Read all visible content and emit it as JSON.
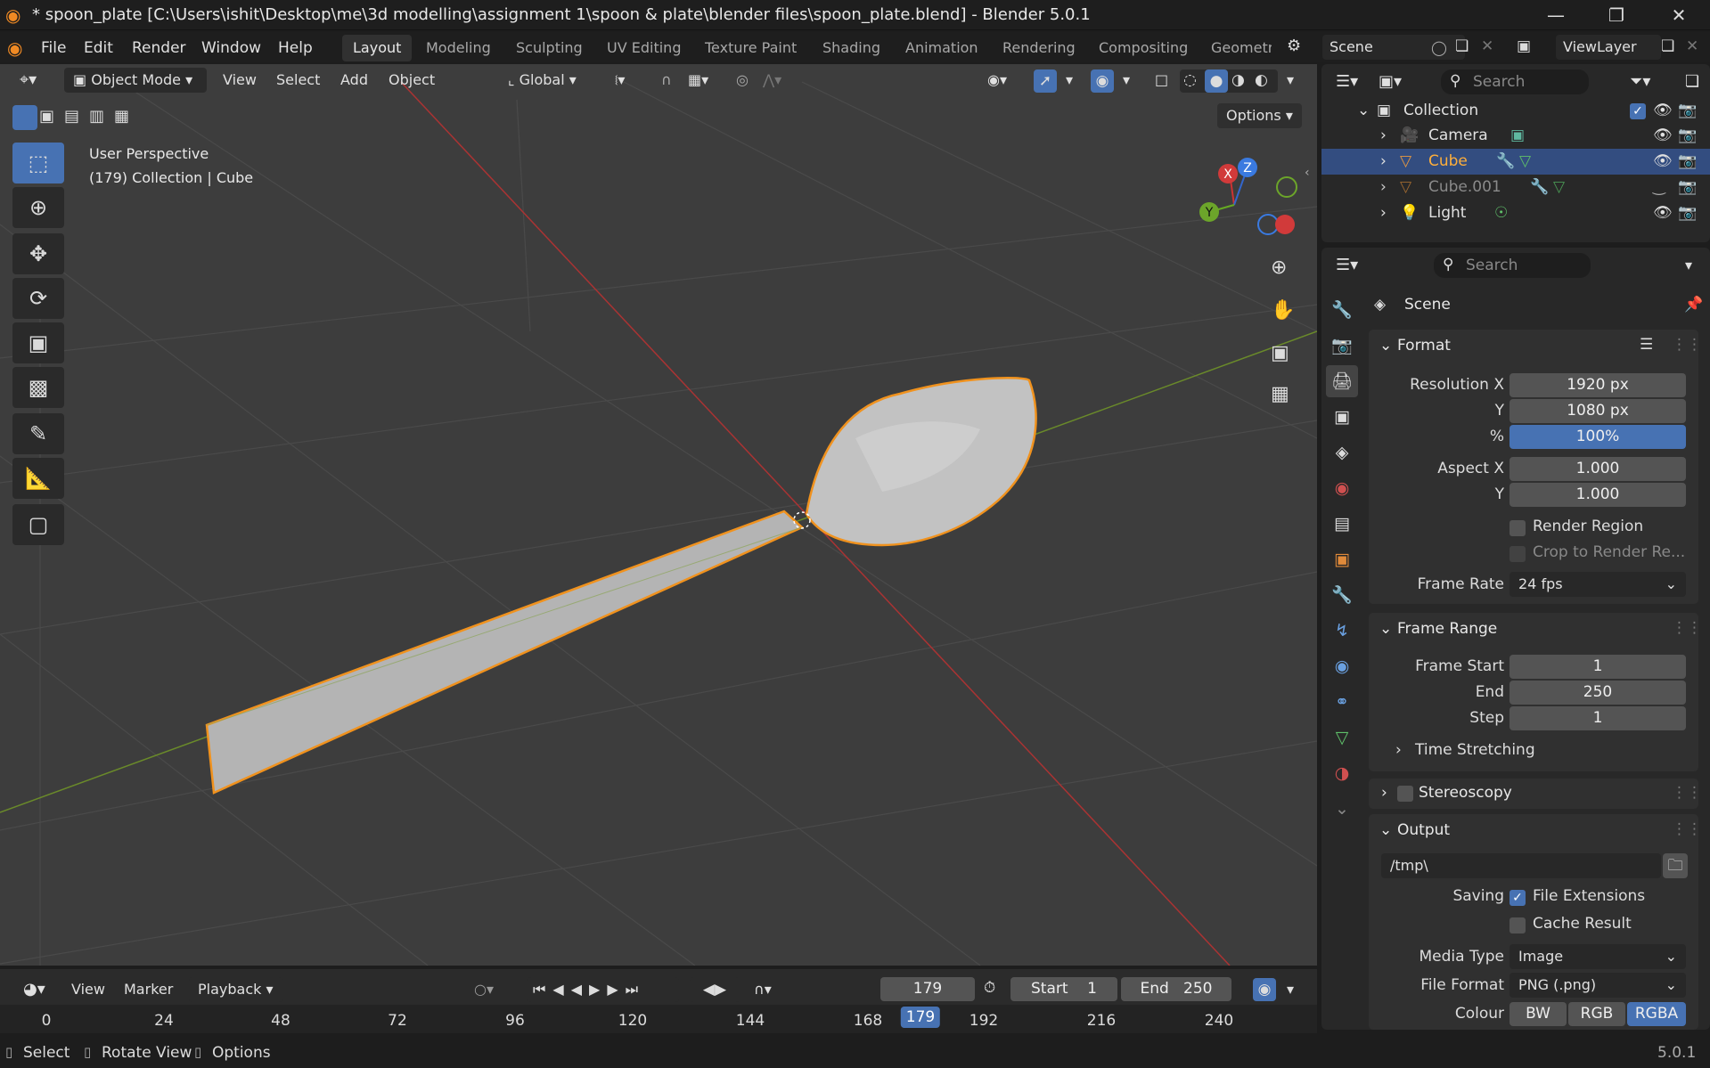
{
  "title_bar": {
    "title": "* spoon_plate [C:\\Users\\ishit\\Desktop\\me\\3d modelling\\assignment 1\\spoon & plate\\blender files\\spoon_plate.blend] - Blender 5.0.1"
  },
  "menu": [
    "File",
    "Edit",
    "Render",
    "Window",
    "Help"
  ],
  "workspaces": [
    "Layout",
    "Modeling",
    "Sculpting",
    "UV Editing",
    "Texture Paint",
    "Shading",
    "Animation",
    "Rendering",
    "Compositing",
    "Geometr"
  ],
  "scene_name": "Scene",
  "view_layer": "ViewLayer",
  "viewport_header": {
    "mode": "Object Mode",
    "menus": [
      "View",
      "Select",
      "Add",
      "Object"
    ],
    "orientation": "Global",
    "options": "Options"
  },
  "viewport_overlay": {
    "perspective": "User Perspective",
    "context": "(179) Collection | Cube"
  },
  "gizmo": {
    "x": "X",
    "y": "Y",
    "z": "Z"
  },
  "outliner": {
    "search_placeholder": "Search",
    "collection": "Collection",
    "items": [
      {
        "name": "Camera",
        "selected": false
      },
      {
        "name": "Cube",
        "selected": true
      },
      {
        "name": "Cube.001",
        "selected": false
      },
      {
        "name": "Light",
        "selected": false
      }
    ]
  },
  "properties": {
    "search_placeholder": "Search",
    "context": "Scene",
    "format": {
      "header": "Format",
      "resolution_x_label": "Resolution X",
      "resolution_x": "1920 px",
      "resolution_y_label": "Y",
      "resolution_y": "1080 px",
      "percent_label": "%",
      "percent": "100%",
      "aspect_x_label": "Aspect X",
      "aspect_x": "1.000",
      "aspect_y_label": "Y",
      "aspect_y": "1.000",
      "render_region": "Render Region",
      "crop": "Crop to Render Re...",
      "frame_rate_label": "Frame Rate",
      "frame_rate": "24 fps"
    },
    "frame_range": {
      "header": "Frame Range",
      "start_label": "Frame Start",
      "start": "1",
      "end_label": "End",
      "end": "250",
      "step_label": "Step",
      "step": "1",
      "time_stretching": "Time Stretching"
    },
    "stereoscopy": "Stereoscopy",
    "output": {
      "header": "Output",
      "path": "/tmp\\",
      "saving_label": "Saving",
      "file_extensions": "File Extensions",
      "cache_result": "Cache Result",
      "media_type_label": "Media Type",
      "media_type": "Image",
      "file_format_label": "File Format",
      "file_format": "PNG (.png)",
      "colour_label": "Colour",
      "colour_options": [
        "BW",
        "RGB",
        "RGBA"
      ],
      "colour_selected": "RGBA"
    }
  },
  "timeline": {
    "menus": [
      "View",
      "Marker",
      "Playback"
    ],
    "current_frame": "179",
    "start_label": "Start",
    "start": "1",
    "end_label": "End",
    "end": "250",
    "ticks": [
      "0",
      "24",
      "48",
      "72",
      "96",
      "120",
      "144",
      "168",
      "179",
      "192",
      "216",
      "240"
    ]
  },
  "status_bar": {
    "select": "Select",
    "rotate": "Rotate View",
    "options": "Options",
    "version": "5.0.1"
  }
}
